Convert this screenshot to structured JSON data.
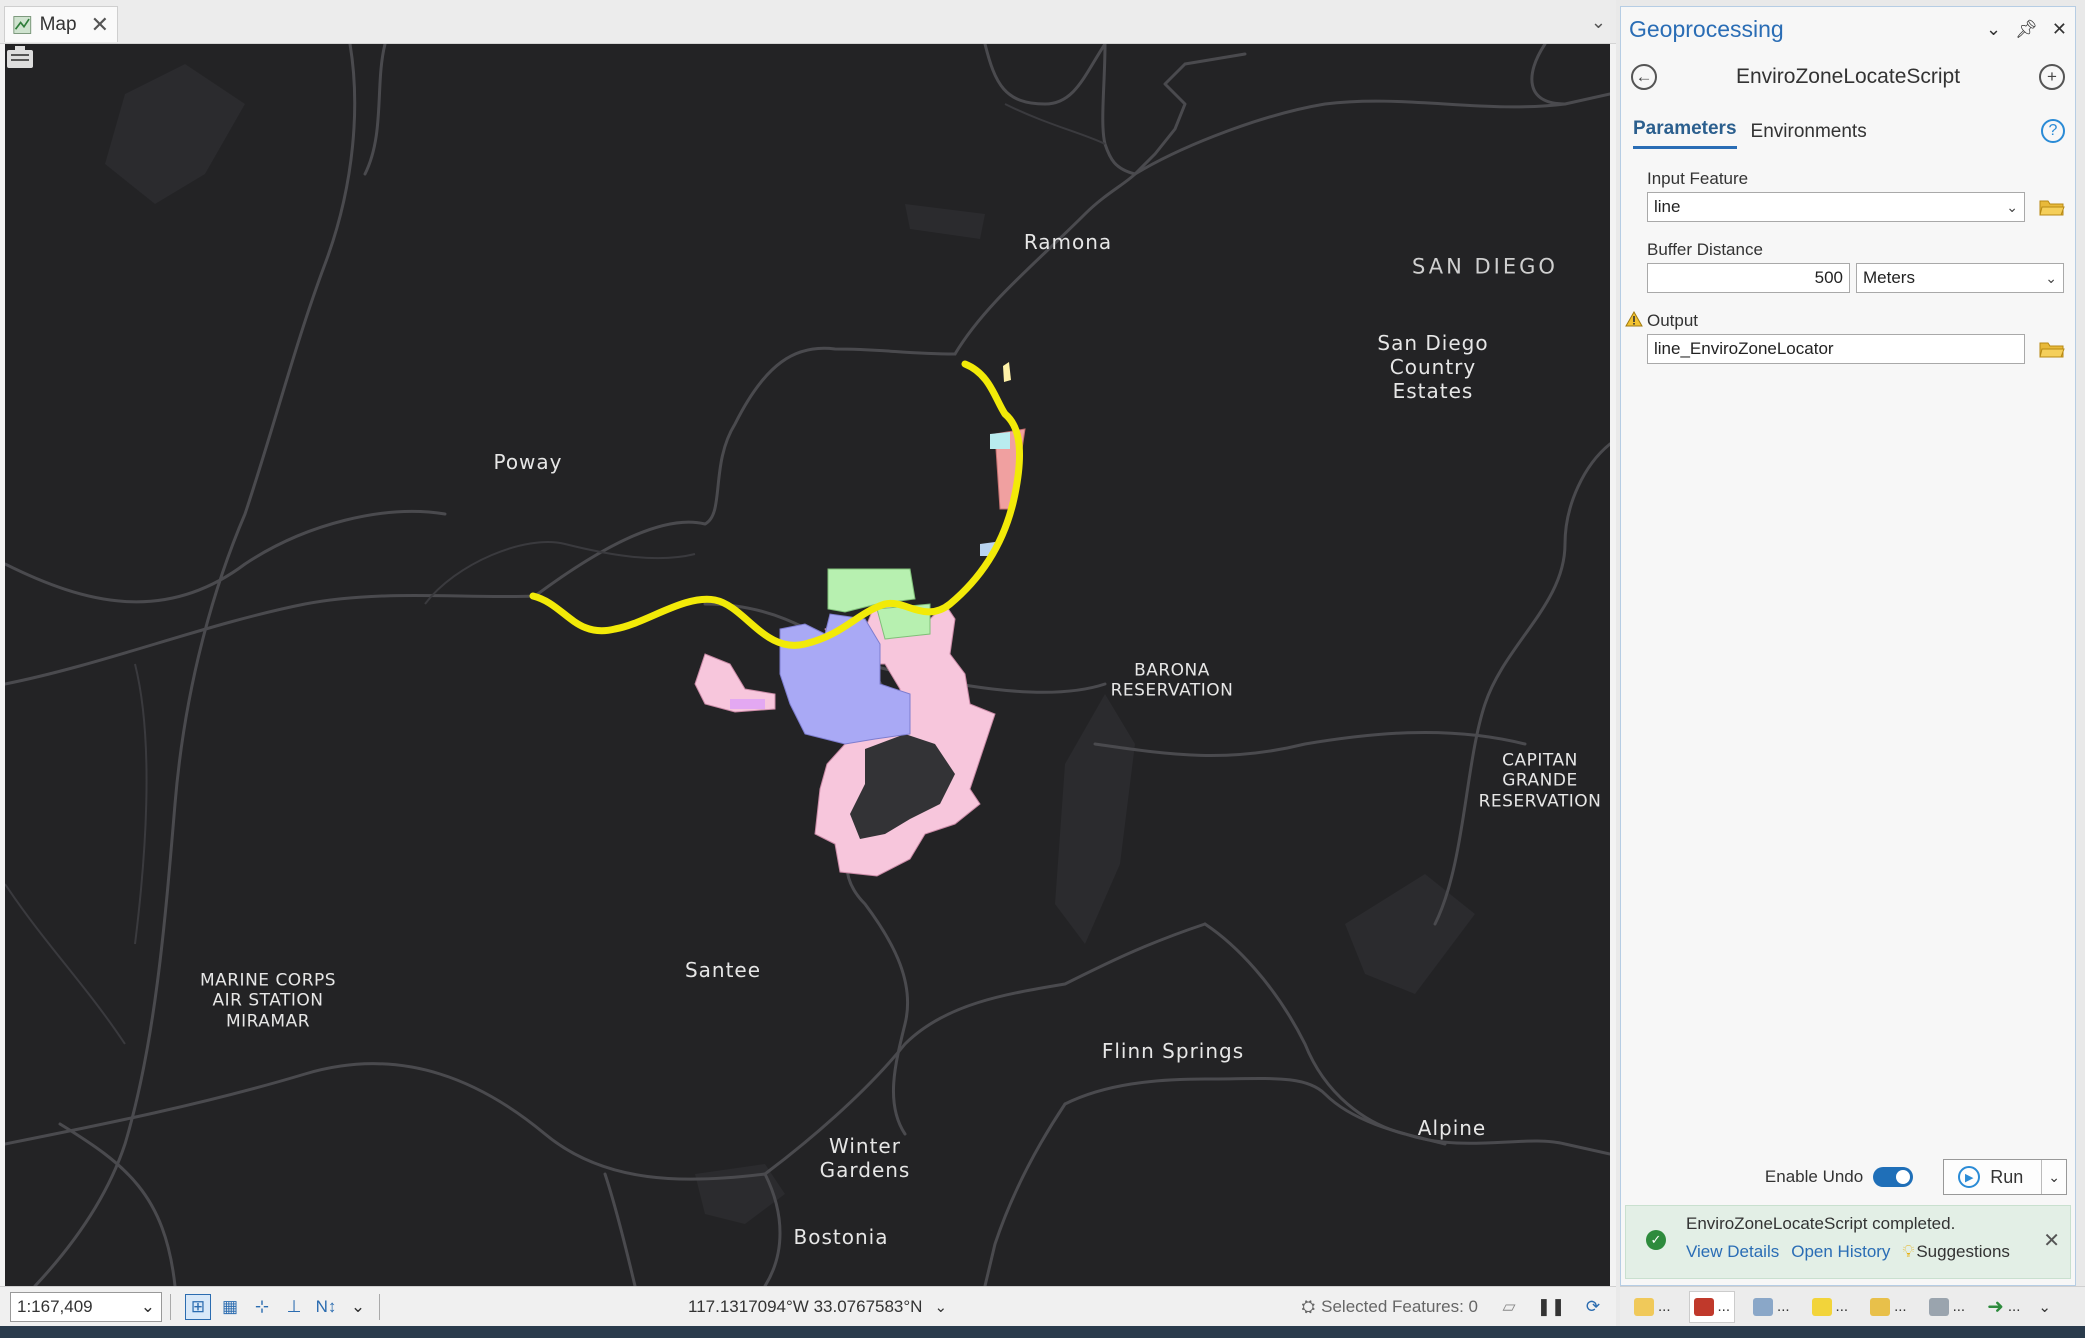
{
  "map_tab": {
    "label": "Map"
  },
  "map_labels": {
    "ramona": "Ramona",
    "san_diego_county": "SAN DIEGO",
    "sd_country_estates": "San Diego\nCountry\nEstates",
    "poway": "Poway",
    "barona": "BARONA\nRESERVATION",
    "capitan_grande": "CAPITAN\nGRANDE\nRESERVATION",
    "marine_corps": "MARINE CORPS\nAIR STATION\nMIRAMAR",
    "santee": "Santee",
    "flinn_springs": "Flinn Springs",
    "alpine": "Alpine",
    "winter_gardens": "Winter\nGardens",
    "bostonia": "Bostonia"
  },
  "statusbar": {
    "scale": "1:167,409",
    "coordinates": "117.1317094°W 33.0767583°N",
    "selected_features": "Selected Features: 0"
  },
  "geoprocessing": {
    "pane_title": "Geoprocessing",
    "tool_name": "EnviroZoneLocateScript",
    "tabs": [
      {
        "label": "Parameters",
        "active": true
      },
      {
        "label": "Environments",
        "active": false
      }
    ],
    "params": {
      "input_feature": {
        "label": "Input Feature",
        "value": "line"
      },
      "buffer_distance": {
        "label": "Buffer Distance",
        "value": "500",
        "unit": "Meters"
      },
      "output": {
        "label": "Output",
        "value": "line_EnviroZoneLocator",
        "warning": true
      }
    },
    "enable_undo": {
      "label": "Enable Undo",
      "on": true
    },
    "run_label": "Run",
    "status": {
      "message": "EnviroZoneLocateScript completed.",
      "view_details": "View Details",
      "open_history": "Open History",
      "suggestions": "Suggestions"
    }
  },
  "dock_tabs": [
    "...",
    "...",
    "...",
    "...",
    "...",
    "...",
    "..."
  ],
  "colors": {
    "map_background": "#232325",
    "route_line": "#f2ea08",
    "zone_pink": "#f7c6dc",
    "zone_blue": "#a9a9f5",
    "zone_green": "#b7f0b0",
    "zone_red": "#f0a0a0",
    "accent": "#2a6db5"
  }
}
